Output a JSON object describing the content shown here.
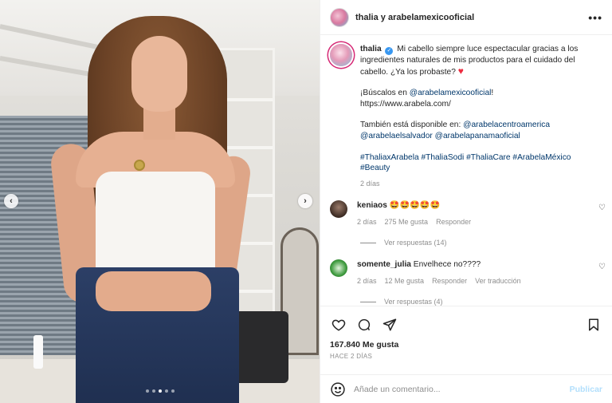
{
  "post": {
    "header_name": "thalia y arabelamexicooficial",
    "caption": {
      "username": "thalia",
      "text_main": "Mi cabello siempre luce espectacular gracias a los ingredientes naturales de mis productos para el cuidado del cabello. ¿Ya los probaste?",
      "find_prefix": "¡Búscalos en ",
      "find_mention": "@arabelamexicooficial",
      "find_suffix": "!",
      "url": "https://www.arabela.com/",
      "also_prefix": "También está disponible en: ",
      "also_mention_1": "@arabelacentroamerica",
      "also_mention_2": "@arabelaelsalvador",
      "also_mention_3": "@arabelapanamaoficial",
      "hashtags": "#ThaliaxArabela #ThaliaSodi #ThaliaCare #ArabelaMéxico #Beauty",
      "time": "2 días"
    },
    "comments": [
      {
        "username": "keniaos",
        "text": "🤩🤩🤩🤩🤩",
        "time": "2 días",
        "likes": "275 Me gusta",
        "reply_label": "Responder",
        "view_replies": "Ver respuestas (14)"
      },
      {
        "username": "somente_julia",
        "text": "Envelhece no????",
        "time": "2 días",
        "likes": "12 Me gusta",
        "reply_label": "Responder",
        "translate_label": "Ver traducción",
        "view_replies": "Ver respuestas (4)"
      }
    ],
    "likes_count": "167.840 Me gusta",
    "date": "HACE 2 DÍAS",
    "comment_placeholder": "Añade un comentario...",
    "publish_label": "Publicar"
  },
  "carousel": {
    "prev_icon": "‹",
    "next_icon": "›",
    "slides": 5,
    "active_slide": 3
  },
  "colors": {
    "link": "#00376b",
    "verified": "#3897f0",
    "heart": "#ed2b3f",
    "publish_disabled": "#b2dffc",
    "muted": "#8e8e8e"
  }
}
